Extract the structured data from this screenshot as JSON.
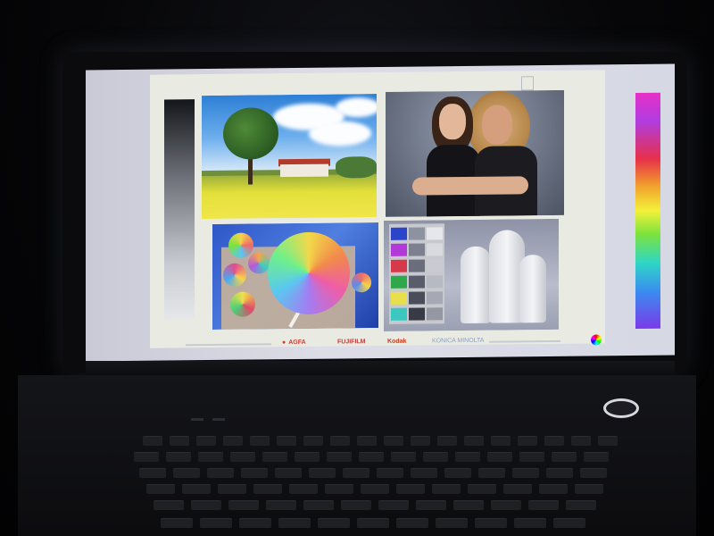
{
  "screen": {
    "brands": {
      "agfa": "AGFA",
      "fujifilm": "FUJIFILM",
      "kodak": "Kodak",
      "konica_minolta": "KONICA MINOLTA"
    },
    "photos": [
      "landscape",
      "two-women-portrait",
      "pinwheels",
      "color-test-chart"
    ],
    "colors": {
      "panel_bg": "#e9ebe3",
      "screen_bg": "#d6d8e4",
      "agfa_red": "#d23a2e",
      "kodak_red": "#c8361c",
      "konica_blue": "#8aa0c2"
    }
  },
  "laptop": {
    "power_button": "power-button-icon"
  }
}
